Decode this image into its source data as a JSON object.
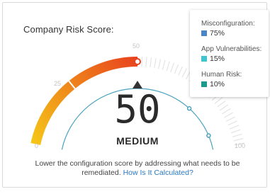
{
  "widget": {
    "title": "Company Risk Score:",
    "score": "50",
    "level": "MEDIUM",
    "score_value": 50,
    "score_max": 100
  },
  "gauge": {
    "ticks": [
      "0",
      "25",
      "50",
      "100"
    ],
    "colors": {
      "gradient_start": "#f5c518",
      "gradient_end": "#e8431e",
      "track": "#e4e4e4",
      "inner_ring": "#4aa3c0",
      "pointer": "#333333"
    }
  },
  "footer": {
    "text": "Lower the configuration score by addressing what needs to be remediated.",
    "link": "How Is It Calculated?"
  },
  "legend": {
    "items": [
      {
        "label": "Misconfiguration:",
        "value": "75%",
        "color": "#4a86c5"
      },
      {
        "label": "App Vulnerabilities:",
        "value": "15%",
        "color": "#40c4d0"
      },
      {
        "label": "Human Risk:",
        "value": "10%",
        "color": "#1a9a8c"
      }
    ]
  }
}
